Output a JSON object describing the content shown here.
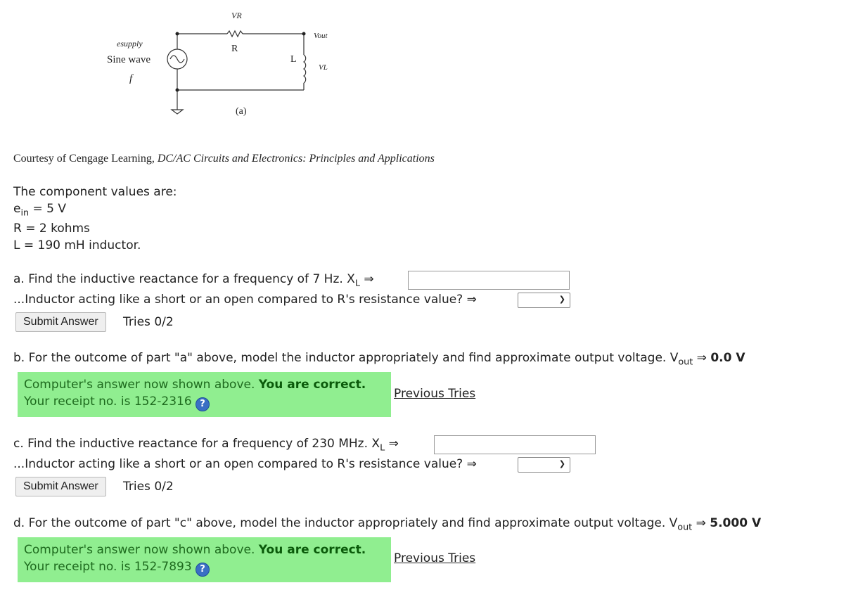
{
  "figure": {
    "vr_label": "VR",
    "vout_label": "Vout",
    "supply_label": "esupply",
    "wave_label": "Sine wave",
    "freq_label": "f",
    "r_label": "R",
    "l_label": "L",
    "vl_label": "VL",
    "caption": "(a)"
  },
  "credit": {
    "prefix": "Courtesy of Cengage Learning, ",
    "title": "DC/AC Circuits and Electronics: Principles and Applications"
  },
  "components": {
    "heading": "The component values are:",
    "ein_base": "e",
    "ein_sub": "in",
    "ein_value": " = 5 V",
    "r_line": "R = 2 kohms",
    "l_line": "L = 190 mH inductor."
  },
  "part_a": {
    "question": "a. Find the inductive reactance for a frequency of 7 Hz. X",
    "sub": "L",
    "arrow": " ⇒",
    "reactance_value": "",
    "short_open_prompt": "...Inductor acting like a short or an open compared to R's resistance value? ⇒",
    "select_value": "",
    "submit_label": "Submit Answer",
    "tries": "Tries 0/2"
  },
  "part_b": {
    "question": "b. For the outcome of part \"a\" above, model the inductor appropriately and find approximate output voltage. V",
    "sub": "out",
    "arrow": " ⇒ ",
    "answer": "0.0 V",
    "status_text": "Computer's answer now shown above. ",
    "status_bold": "You are correct.",
    "receipt": "Your receipt no. is 152-2316 ",
    "previous_tries": "Previous Tries"
  },
  "part_c": {
    "question": "c. Find the inductive reactance for a frequency of 230 MHz. X",
    "sub": "L",
    "arrow": " ⇒",
    "reactance_value": "",
    "short_open_prompt": "...Inductor acting like a short or an open compared to R's resistance value? ⇒",
    "select_value": "",
    "submit_label": "Submit Answer",
    "tries": "Tries 0/2"
  },
  "part_d": {
    "question": "d. For the outcome of part \"c\" above, model the inductor appropriately and find approximate output voltage. V",
    "sub": "out",
    "arrow": " ⇒ ",
    "answer": "5.000 V",
    "status_text": "Computer's answer now shown above. ",
    "status_bold": "You are correct.",
    "receipt": "Your receipt no. is 152-7893 ",
    "previous_tries": "Previous Tries"
  },
  "icons": {
    "help": "help-icon",
    "chevron": "chevron-down-icon"
  },
  "colors": {
    "correct_bg": "#90ee90",
    "correct_text": "#1e6b1e",
    "help_icon": "#3a6fc4"
  }
}
